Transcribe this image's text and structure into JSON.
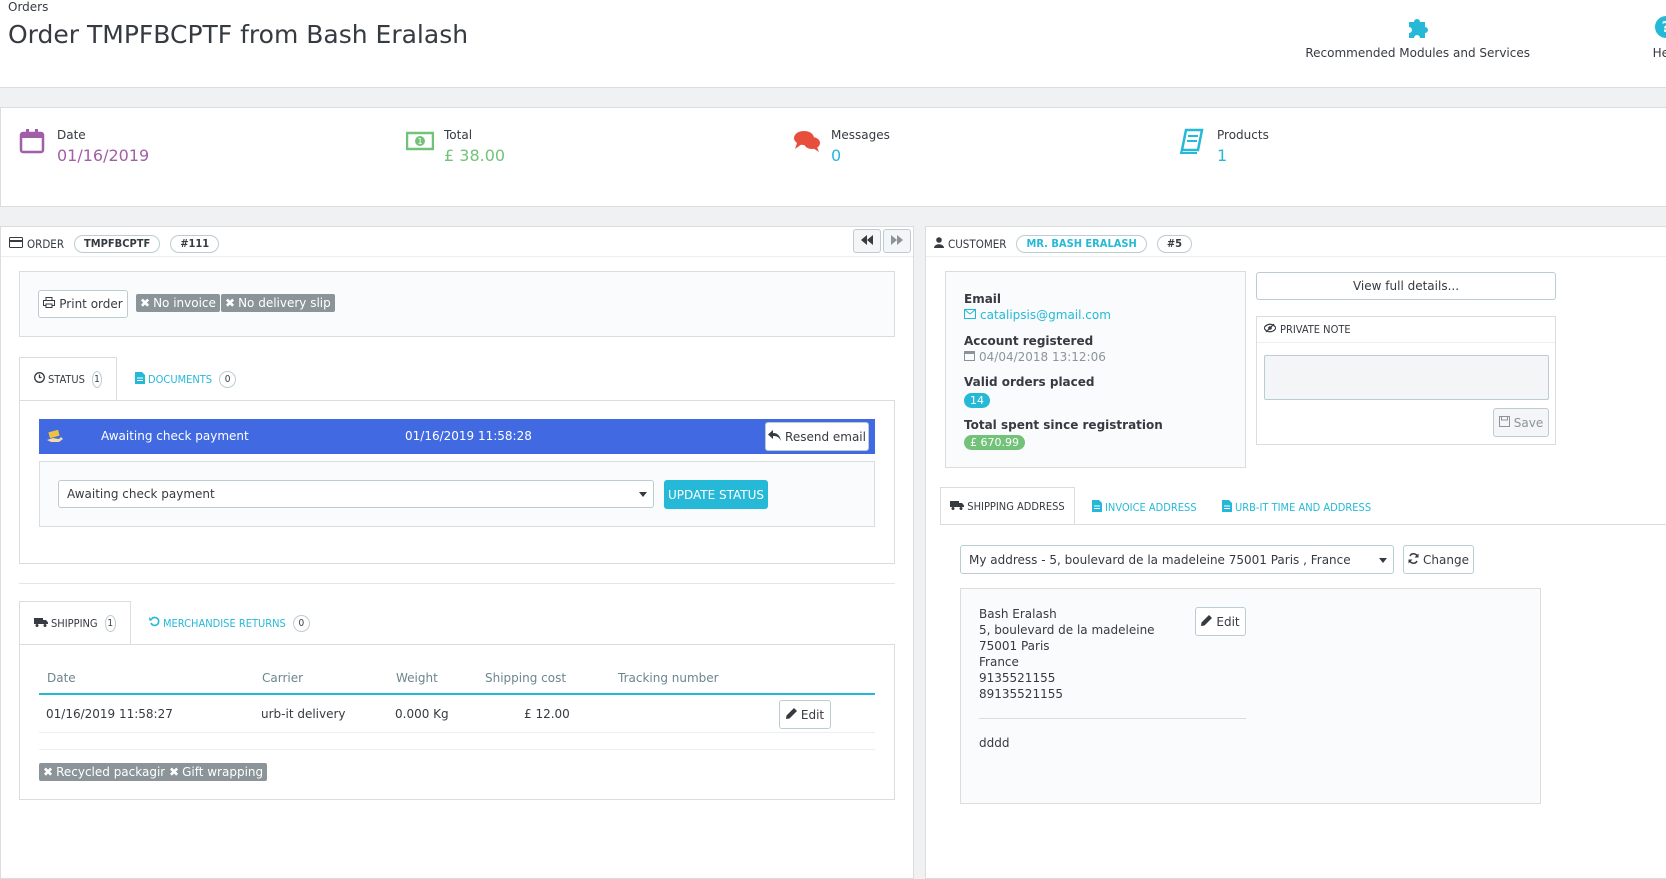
{
  "header": {
    "breadcrumb": "Orders",
    "title": "Order TMPFBCPTF from Bash Eralash",
    "toolbar": [
      {
        "label": "Recommended Modules and Services",
        "icon": "puzzle-icon"
      },
      {
        "label": "Help",
        "icon": "help-icon"
      }
    ]
  },
  "kpis": [
    {
      "label": "Date",
      "value": "01/16/2019",
      "icon": "calendar-icon",
      "color": "#a05fa6"
    },
    {
      "label": "Total",
      "value": "£ 38.00",
      "icon": "money-icon",
      "color": "#72c279"
    },
    {
      "label": "Messages",
      "value": "0",
      "icon": "comments-icon",
      "color": "#25b9d7"
    },
    {
      "label": "Products",
      "value": "1",
      "icon": "book-icon",
      "color": "#25b9d7"
    }
  ],
  "order": {
    "heading": "ORDER",
    "reference": "TMPFBCPTF",
    "number": "#111",
    "actions": {
      "print_label": "Print order",
      "no_invoice": "No invoice",
      "no_delivery_slip": "No delivery slip"
    },
    "status_tabs": [
      {
        "label": "STATUS",
        "count": "1"
      },
      {
        "label": "DOCUMENTS",
        "count": "0"
      }
    ],
    "status_history": {
      "state": "Awaiting check payment",
      "date": "01/16/2019 11:58:28",
      "resend_label": "Resend email"
    },
    "status_select": {
      "selected": "Awaiting check payment",
      "button": "UPDATE STATUS"
    },
    "shipping_tabs": [
      {
        "label": "SHIPPING",
        "count": "1"
      },
      {
        "label": "MERCHANDISE RETURNS",
        "count": "0"
      }
    ],
    "shipping_table": {
      "headers": [
        "Date",
        "Carrier",
        "Weight",
        "Shipping cost",
        "Tracking number"
      ],
      "rows": [
        {
          "date": "01/16/2019 11:58:27",
          "carrier": "urb-it delivery",
          "weight": "0.000 Kg",
          "cost": "£ 12.00",
          "tracking": "",
          "action": "Edit"
        }
      ]
    },
    "options": {
      "recycled": "Recycled packaging",
      "gift": "Gift wrapping"
    }
  },
  "customer": {
    "heading": "CUSTOMER",
    "name": "MR. BASH ERALASH",
    "number": "#5",
    "email_label": "Email",
    "email": "catalipsis@gmail.com",
    "registered_label": "Account registered",
    "registered": "04/04/2018 13:12:06",
    "orders_label": "Valid orders placed",
    "orders": "14",
    "spent_label": "Total spent since registration",
    "spent": "£ 670.99",
    "view_details": "View full details...",
    "private_note": {
      "heading": "PRIVATE NOTE",
      "value": "",
      "save": "Save"
    },
    "address_tabs": [
      {
        "label": "SHIPPING ADDRESS"
      },
      {
        "label": "INVOICE ADDRESS"
      },
      {
        "label": "URB-IT TIME AND ADDRESS"
      }
    ],
    "address_select": "My address - 5, boulevard de la madeleine 75001 Paris , France",
    "change_label": "Change",
    "address_lines": [
      "Bash Eralash",
      "5, boulevard de la madeleine",
      "75001 Paris",
      "France",
      "9135521155",
      "89135521155"
    ],
    "address_edit": "Edit",
    "address_other": "dddd"
  },
  "colors": {
    "primary": "#25b9d7",
    "status_row": "#4169e1",
    "grey_label": "#8b9599",
    "success": "#72c279",
    "purple": "#a05fa6"
  }
}
